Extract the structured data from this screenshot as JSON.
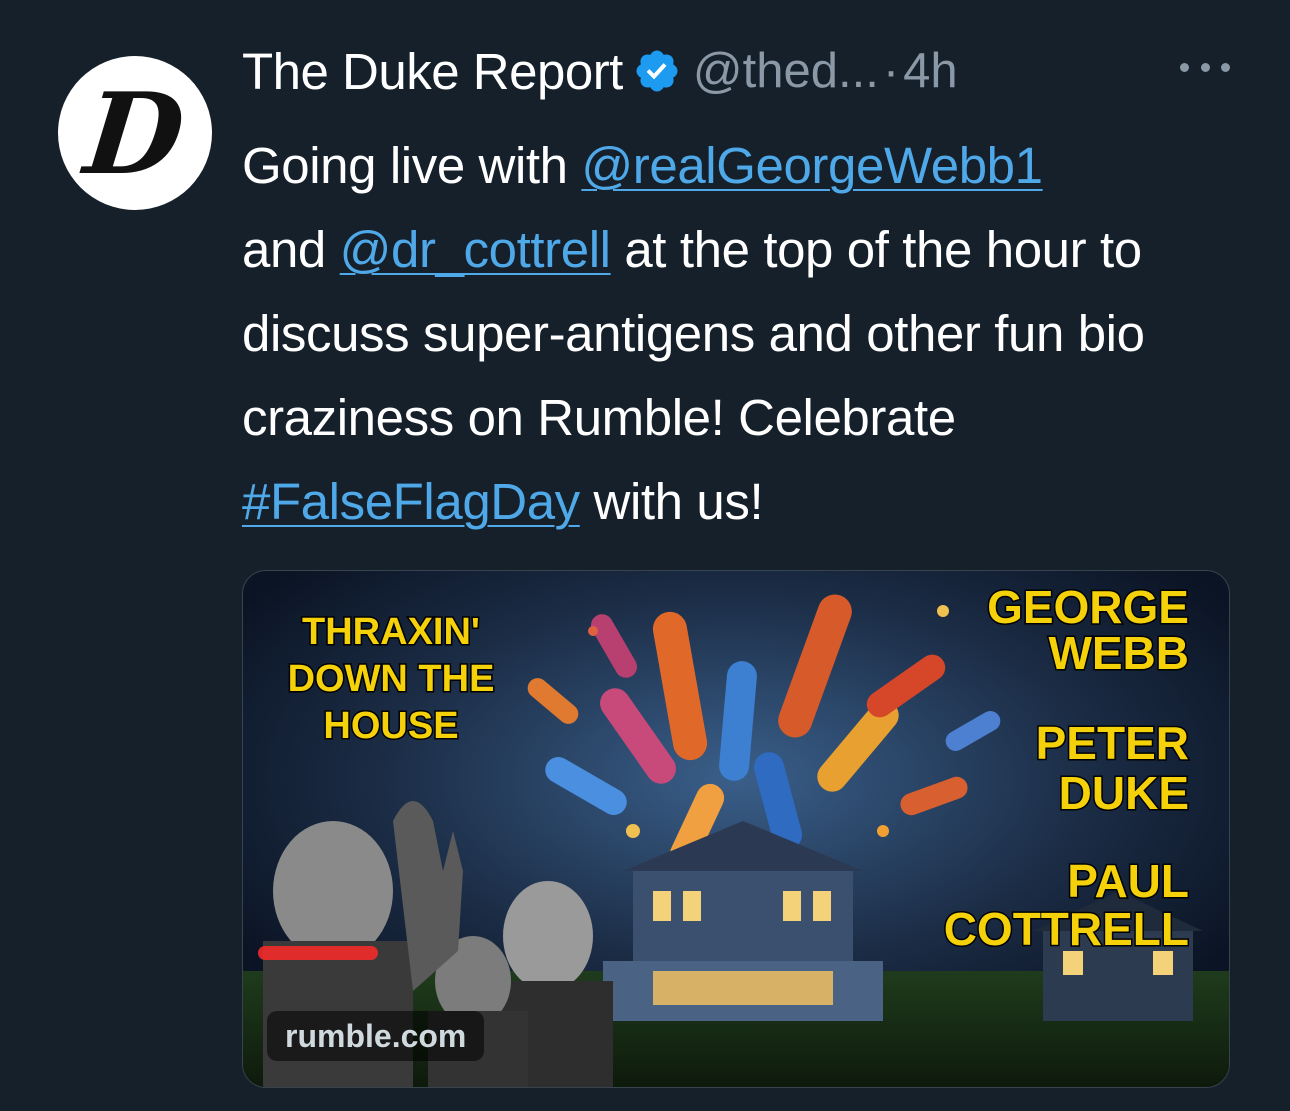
{
  "author": {
    "avatar_letter": "D",
    "display_name": "The Duke Report",
    "handle": "@thed...",
    "separator": "·",
    "time": "4h"
  },
  "tweet": {
    "line1_text": "Going live with ",
    "mention1": "@realGeorgeWebb1",
    "line2_text_a": "and ",
    "mention2": "@dr_cottrell",
    "line2_text_b": " at the top of the hour to discuss super-antigens and other fun bio craziness on Rumble! Celebrate ",
    "hashtag": "#FalseFlagDay",
    "line_end": " with us!"
  },
  "card": {
    "source": "rumble.com",
    "title_lines": [
      "THRAXIN'",
      "DOWN THE",
      "HOUSE"
    ],
    "names": [
      "GEORGE",
      "WEBB",
      "PETER",
      "DUKE",
      "PAUL",
      "COTTRELL"
    ]
  },
  "colors": {
    "background": "#15202b",
    "link": "#4fa8e8",
    "verified": "#1d9bf0",
    "secondary_text": "#8b98a5",
    "poster_yellow": "#f5d10a"
  },
  "icons": {
    "verified": "verified-badge-icon",
    "more": "more-options-icon"
  }
}
